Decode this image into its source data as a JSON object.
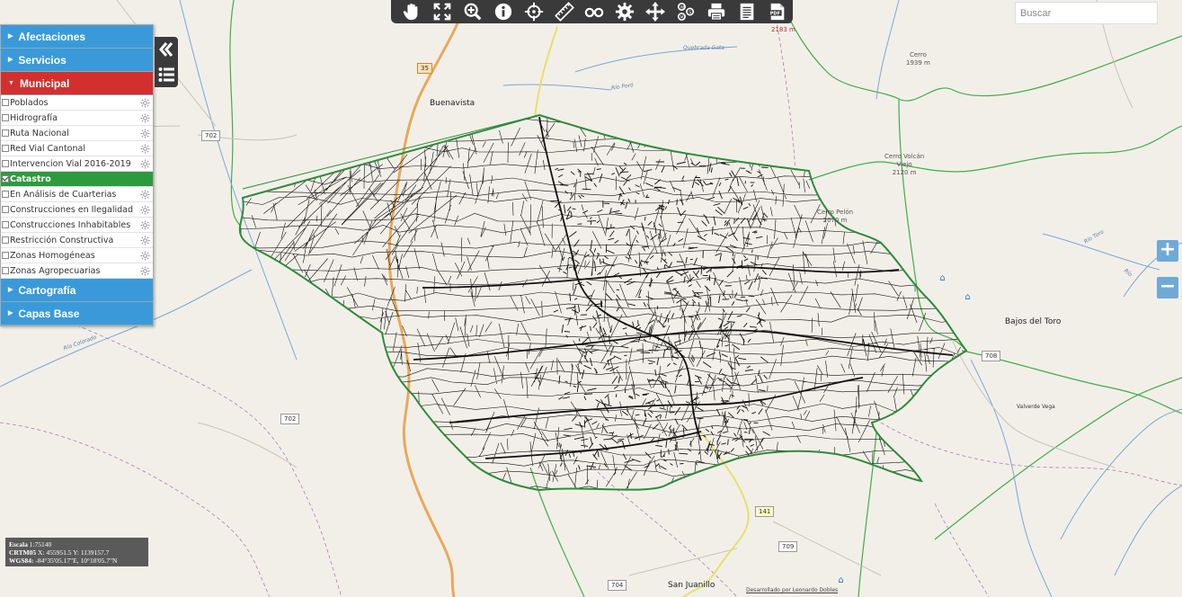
{
  "toolbar": {
    "tools": [
      {
        "name": "pan-tool",
        "icon": "hand-icon"
      },
      {
        "name": "full-extent-tool",
        "icon": "expand-icon"
      },
      {
        "name": "zoom-in-tool",
        "icon": "magnifier-plus-icon"
      },
      {
        "name": "info-tool",
        "icon": "info-icon"
      },
      {
        "name": "locate-tool",
        "icon": "crosshair-icon"
      },
      {
        "name": "measure-tool",
        "icon": "ruler-icon"
      },
      {
        "name": "streetview-tool",
        "icon": "binoculars-icon"
      },
      {
        "name": "settings-tool",
        "icon": "gear-icon"
      },
      {
        "name": "move-tool",
        "icon": "move-arrows-icon"
      },
      {
        "name": "wms-tool",
        "icon": "wms-icon"
      },
      {
        "name": "print-tool",
        "icon": "printer-icon"
      },
      {
        "name": "report-tool",
        "icon": "document-icon"
      },
      {
        "name": "pdf-tool",
        "icon": "pdf-icon"
      }
    ]
  },
  "search": {
    "placeholder": "Buscar"
  },
  "layer_panel": {
    "groups": [
      {
        "label": "Afectaciones",
        "color": "#3a9ad9",
        "expanded": false
      },
      {
        "label": "Servicios",
        "color": "#3a9ad9",
        "expanded": false
      },
      {
        "label": "Municipal",
        "color": "#d32f2f",
        "expanded": true,
        "layers": [
          {
            "label": "Poblados",
            "checked": false
          },
          {
            "label": "Hidrografía",
            "checked": false
          },
          {
            "label": "Ruta Nacional",
            "checked": false
          },
          {
            "label": "Red Vial Cantonal",
            "checked": false
          },
          {
            "label": "Intervencion Vial 2016-2019",
            "checked": false
          },
          {
            "label": "Catastro",
            "checked": true,
            "active": true
          },
          {
            "label": "En Análisis de Cuarterias",
            "checked": false
          },
          {
            "label": "Construcciones en Ilegalidad",
            "checked": false
          },
          {
            "label": "Construcciones Inhabitables",
            "checked": false
          },
          {
            "label": "Restricción Constructiva",
            "checked": false
          },
          {
            "label": "Zonas Homogéneas",
            "checked": false
          },
          {
            "label": "Zonas Agropecuarias",
            "checked": false
          }
        ]
      },
      {
        "label": "Cartografía",
        "color": "#3a9ad9",
        "expanded": false
      },
      {
        "label": "Capas Base",
        "color": "#3a9ad9",
        "expanded": false
      }
    ],
    "active_color": "#2e9a3e"
  },
  "map": {
    "labels": {
      "buenavista": "Buenavista",
      "bajos_del_toro": "Bajos del Toro",
      "valverde_vega": "Valverde Vega",
      "san_juanillo": "San Juanillo",
      "cerro": "Cerro",
      "cerro_elev": "1939 m",
      "cerro_volcan": "Cerro Volcán",
      "viejo": "Viejo",
      "viejo_elev": "2120 m",
      "cerro_pelon": "Cerro Pelón",
      "pelon_elev": "2070 m",
      "peak_top_elev": "2183 m",
      "peak_top_name": "Cerro",
      "quebrada_gata": "Quebrada Gata",
      "rio_poro": "Río Poró",
      "rio_toro": "Río Toro",
      "rio_colorado": "Río Colorado",
      "rio_right": "Río",
      "ruta_nacional_tag": "Ruta Nacional 35"
    },
    "shields": {
      "r35": "35",
      "r702a": "702",
      "r702b": "702",
      "r708": "708",
      "r141": "141",
      "r709": "709",
      "r704": "704"
    },
    "parcel_line_color": "#111111",
    "boundary_color": "#2e8b3a",
    "river_color": "#7aa7d4",
    "road_orange": "#e8a95a",
    "road_yellow": "#f0e68c"
  },
  "zoom": {
    "in": "+",
    "out": "−"
  },
  "coords": {
    "scale_label": "Escala",
    "scale_value": "1:75140",
    "crtm_label": "CRTM05",
    "crtm_value": "X: 455951.5 Y: 1139157.7",
    "wgs_label": "WGS84:",
    "wgs_value": "-84°35'05.17\"E, 10°18'05.7\"N"
  },
  "credit": "Desarrollado por Leonardo Dobles"
}
